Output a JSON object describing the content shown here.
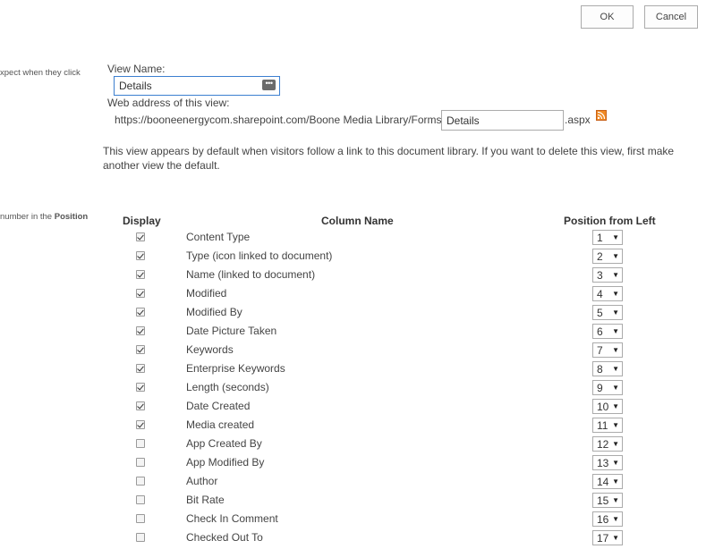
{
  "toolbar": {
    "ok_label": "OK",
    "cancel_label": "Cancel"
  },
  "side": {
    "hint1": "xpect when they click",
    "hint2_prefix": "number in the ",
    "hint2_bold": "Position"
  },
  "view": {
    "name_label": "View Name:",
    "name_value": "Details",
    "web_label": "Web address of this view:",
    "url_prefix": "https://booneenergycom.sharepoint.com/Boone Media Library/Forms/",
    "url_value": "Details",
    "url_suffix": ".aspx",
    "description": "This view appears by default when visitors follow a link to this document library. If you want to delete this view, first make another view the default."
  },
  "table": {
    "headers": {
      "display": "Display",
      "column_name": "Column Name",
      "position": "Position from Left"
    },
    "rows": [
      {
        "checked": true,
        "name": "Content Type",
        "position": "1"
      },
      {
        "checked": true,
        "name": "Type (icon linked to document)",
        "position": "2"
      },
      {
        "checked": true,
        "name": "Name (linked to document)",
        "position": "3"
      },
      {
        "checked": true,
        "name": "Modified",
        "position": "4"
      },
      {
        "checked": true,
        "name": "Modified By",
        "position": "5"
      },
      {
        "checked": true,
        "name": "Date Picture Taken",
        "position": "6"
      },
      {
        "checked": true,
        "name": "Keywords",
        "position": "7"
      },
      {
        "checked": true,
        "name": "Enterprise Keywords",
        "position": "8"
      },
      {
        "checked": true,
        "name": "Length (seconds)",
        "position": "9"
      },
      {
        "checked": true,
        "name": "Date Created",
        "position": "10"
      },
      {
        "checked": true,
        "name": "Media created",
        "position": "11"
      },
      {
        "checked": false,
        "name": "App Created By",
        "position": "12"
      },
      {
        "checked": false,
        "name": "App Modified By",
        "position": "13"
      },
      {
        "checked": false,
        "name": "Author",
        "position": "14"
      },
      {
        "checked": false,
        "name": "Bit Rate",
        "position": "15"
      },
      {
        "checked": false,
        "name": "Check In Comment",
        "position": "16"
      },
      {
        "checked": false,
        "name": "Checked Out To",
        "position": "17"
      }
    ]
  },
  "icons": {
    "rss": "rss-feed-icon",
    "more": "more-options-icon",
    "dropdown": "dropdown-arrow-icon"
  },
  "colors": {
    "focus_border": "#3c7fd0",
    "rss": "#f08a24"
  }
}
